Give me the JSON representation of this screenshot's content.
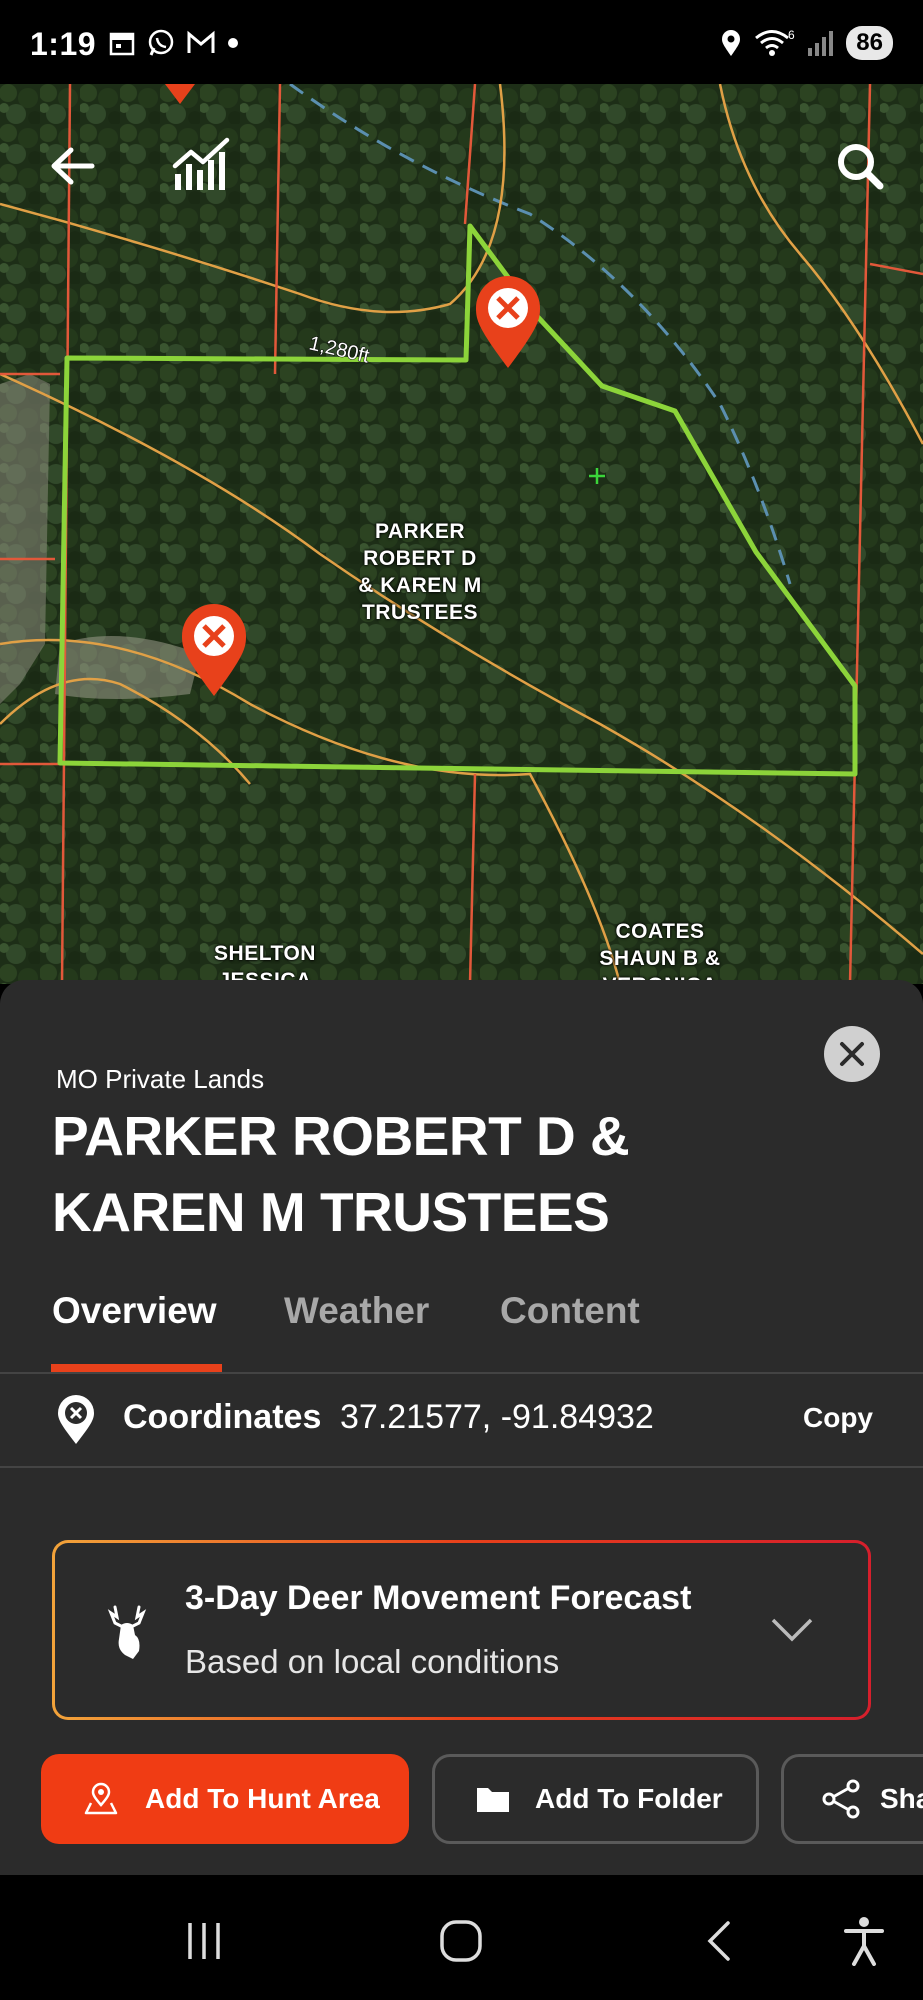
{
  "status_bar": {
    "time": "1:19",
    "wifi_badge": "6",
    "battery": "86",
    "icons": [
      "calendar-icon",
      "whatsapp-icon",
      "gmail-icon",
      "dot-icon",
      "location-icon",
      "wifi-icon",
      "signal-icon",
      "battery-icon"
    ]
  },
  "map": {
    "parcel_label": [
      "PARKER",
      "ROBERT D",
      "& KAREN M",
      "TRUSTEES"
    ],
    "neighbor_left": [
      "SHELTON",
      "JESSICA"
    ],
    "neighbor_right": [
      "COATES",
      "SHAUN B &",
      "VERONICA"
    ],
    "contour_label": "1,280ft",
    "colors": {
      "boundary": "#8cd43a",
      "property_lines": "#e2583a",
      "contours": "#e0a046",
      "stream": "#5b8fb0",
      "marker": "#e8411b"
    }
  },
  "sheet": {
    "category": "MO Private Lands",
    "title": "PARKER ROBERT D & KAREN M TRUSTEES",
    "tabs": [
      "Overview",
      "Weather",
      "Content"
    ],
    "active_tab": "Overview",
    "coordinates": {
      "label": "Coordinates",
      "value": "37.21577, -91.84932",
      "copy": "Copy"
    },
    "forecast": {
      "title": "3-Day Deer Movement Forecast",
      "subtitle": "Based on local conditions"
    },
    "actions": {
      "hunt_area": "Add To Hunt Area",
      "folder": "Add To Folder",
      "share": "Share"
    }
  },
  "colors": {
    "accent": "#e8411b",
    "sheet_bg": "#2b2b2b"
  }
}
